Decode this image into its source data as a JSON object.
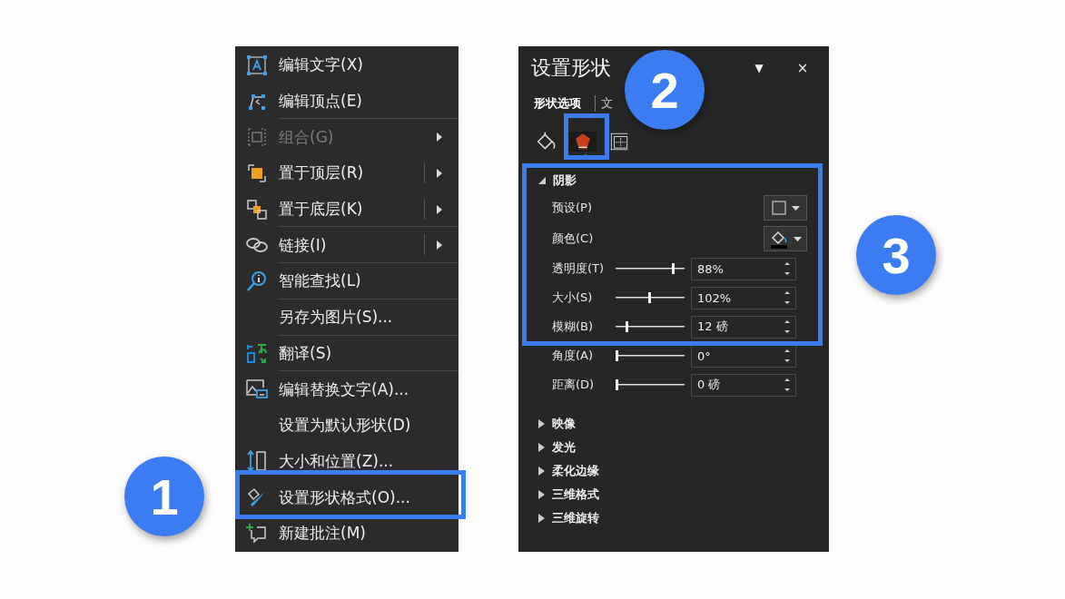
{
  "menu": {
    "items": [
      {
        "kind": "text-box",
        "label": "编辑文字(X)",
        "disabled": false,
        "submenu": false,
        "separator_after": false
      },
      {
        "kind": "edit-points",
        "label": "编辑顶点(E)",
        "disabled": false,
        "submenu": false,
        "separator_after": true
      },
      {
        "kind": "group",
        "label": "组合(G)",
        "disabled": true,
        "submenu": true,
        "split": false,
        "separator_after": false
      },
      {
        "kind": "bring-front",
        "label": "置于顶层(R)",
        "disabled": false,
        "submenu": true,
        "split": true,
        "separator_after": false
      },
      {
        "kind": "send-back",
        "label": "置于底层(K)",
        "disabled": false,
        "submenu": true,
        "split": true,
        "separator_after": true
      },
      {
        "kind": "link",
        "label": "链接(I)",
        "disabled": false,
        "submenu": true,
        "split": true,
        "separator_after": true
      },
      {
        "kind": "lookup",
        "label": "智能查找(L)",
        "disabled": false,
        "submenu": false,
        "separator_after": true
      },
      {
        "kind": "none",
        "label": "另存为图片(S)...",
        "disabled": false,
        "submenu": false,
        "separator_after": true
      },
      {
        "kind": "translate",
        "label": "翻译(S)",
        "disabled": false,
        "submenu": false,
        "separator_after": true
      },
      {
        "kind": "alt-text",
        "label": "编辑替换文字(A)...",
        "disabled": false,
        "submenu": false,
        "separator_after": false
      },
      {
        "kind": "none",
        "label": "设置为默认形状(D)",
        "disabled": false,
        "submenu": false,
        "separator_after": false
      },
      {
        "kind": "size",
        "label": "大小和位置(Z)...",
        "disabled": false,
        "submenu": false,
        "separator_after": false
      },
      {
        "kind": "format",
        "label": "设置形状格式(O)...",
        "disabled": false,
        "submenu": false
      },
      {
        "kind": "comment",
        "label": "新建批注(M)",
        "disabled": false,
        "submenu": false,
        "separator_after": false
      }
    ]
  },
  "panel": {
    "title": "设置形状",
    "menu_glyph": "▼",
    "close_glyph": "×",
    "tabs": [
      {
        "label": "形状选项",
        "selected": true
      },
      {
        "label": "文",
        "selected": false
      }
    ],
    "icon_tabs": [
      {
        "kind": "fill",
        "selected": false
      },
      {
        "kind": "effects",
        "selected": true
      },
      {
        "kind": "layout",
        "selected": false
      }
    ],
    "sections": [
      {
        "label": "阴影",
        "expanded": true,
        "rows": [
          {
            "kind": "preset",
            "label": "预设(P)"
          },
          {
            "kind": "color",
            "label": "颜色(C)"
          },
          {
            "kind": "slider",
            "label": "透明度(T)",
            "level": 0.89,
            "value": "88%"
          },
          {
            "kind": "slider",
            "label": "大小(S)",
            "level": 0.51,
            "value": "102%"
          },
          {
            "kind": "slider",
            "label": "模糊(B)",
            "level": 0.16,
            "value": "12 磅"
          },
          {
            "kind": "slider",
            "label": "角度(A)",
            "level": 0,
            "value": "0°"
          },
          {
            "kind": "slider",
            "label": "距离(D)",
            "level": 0,
            "value": "0 磅"
          }
        ]
      },
      {
        "label": "映像",
        "expanded": false
      },
      {
        "label": "发光",
        "expanded": false
      },
      {
        "label": "柔化边缘",
        "expanded": false
      },
      {
        "label": "三维格式",
        "expanded": false
      },
      {
        "label": "三维旋转",
        "expanded": false
      }
    ]
  },
  "badges": [
    {
      "label": "1"
    },
    {
      "label": "2"
    },
    {
      "label": "3"
    }
  ]
}
